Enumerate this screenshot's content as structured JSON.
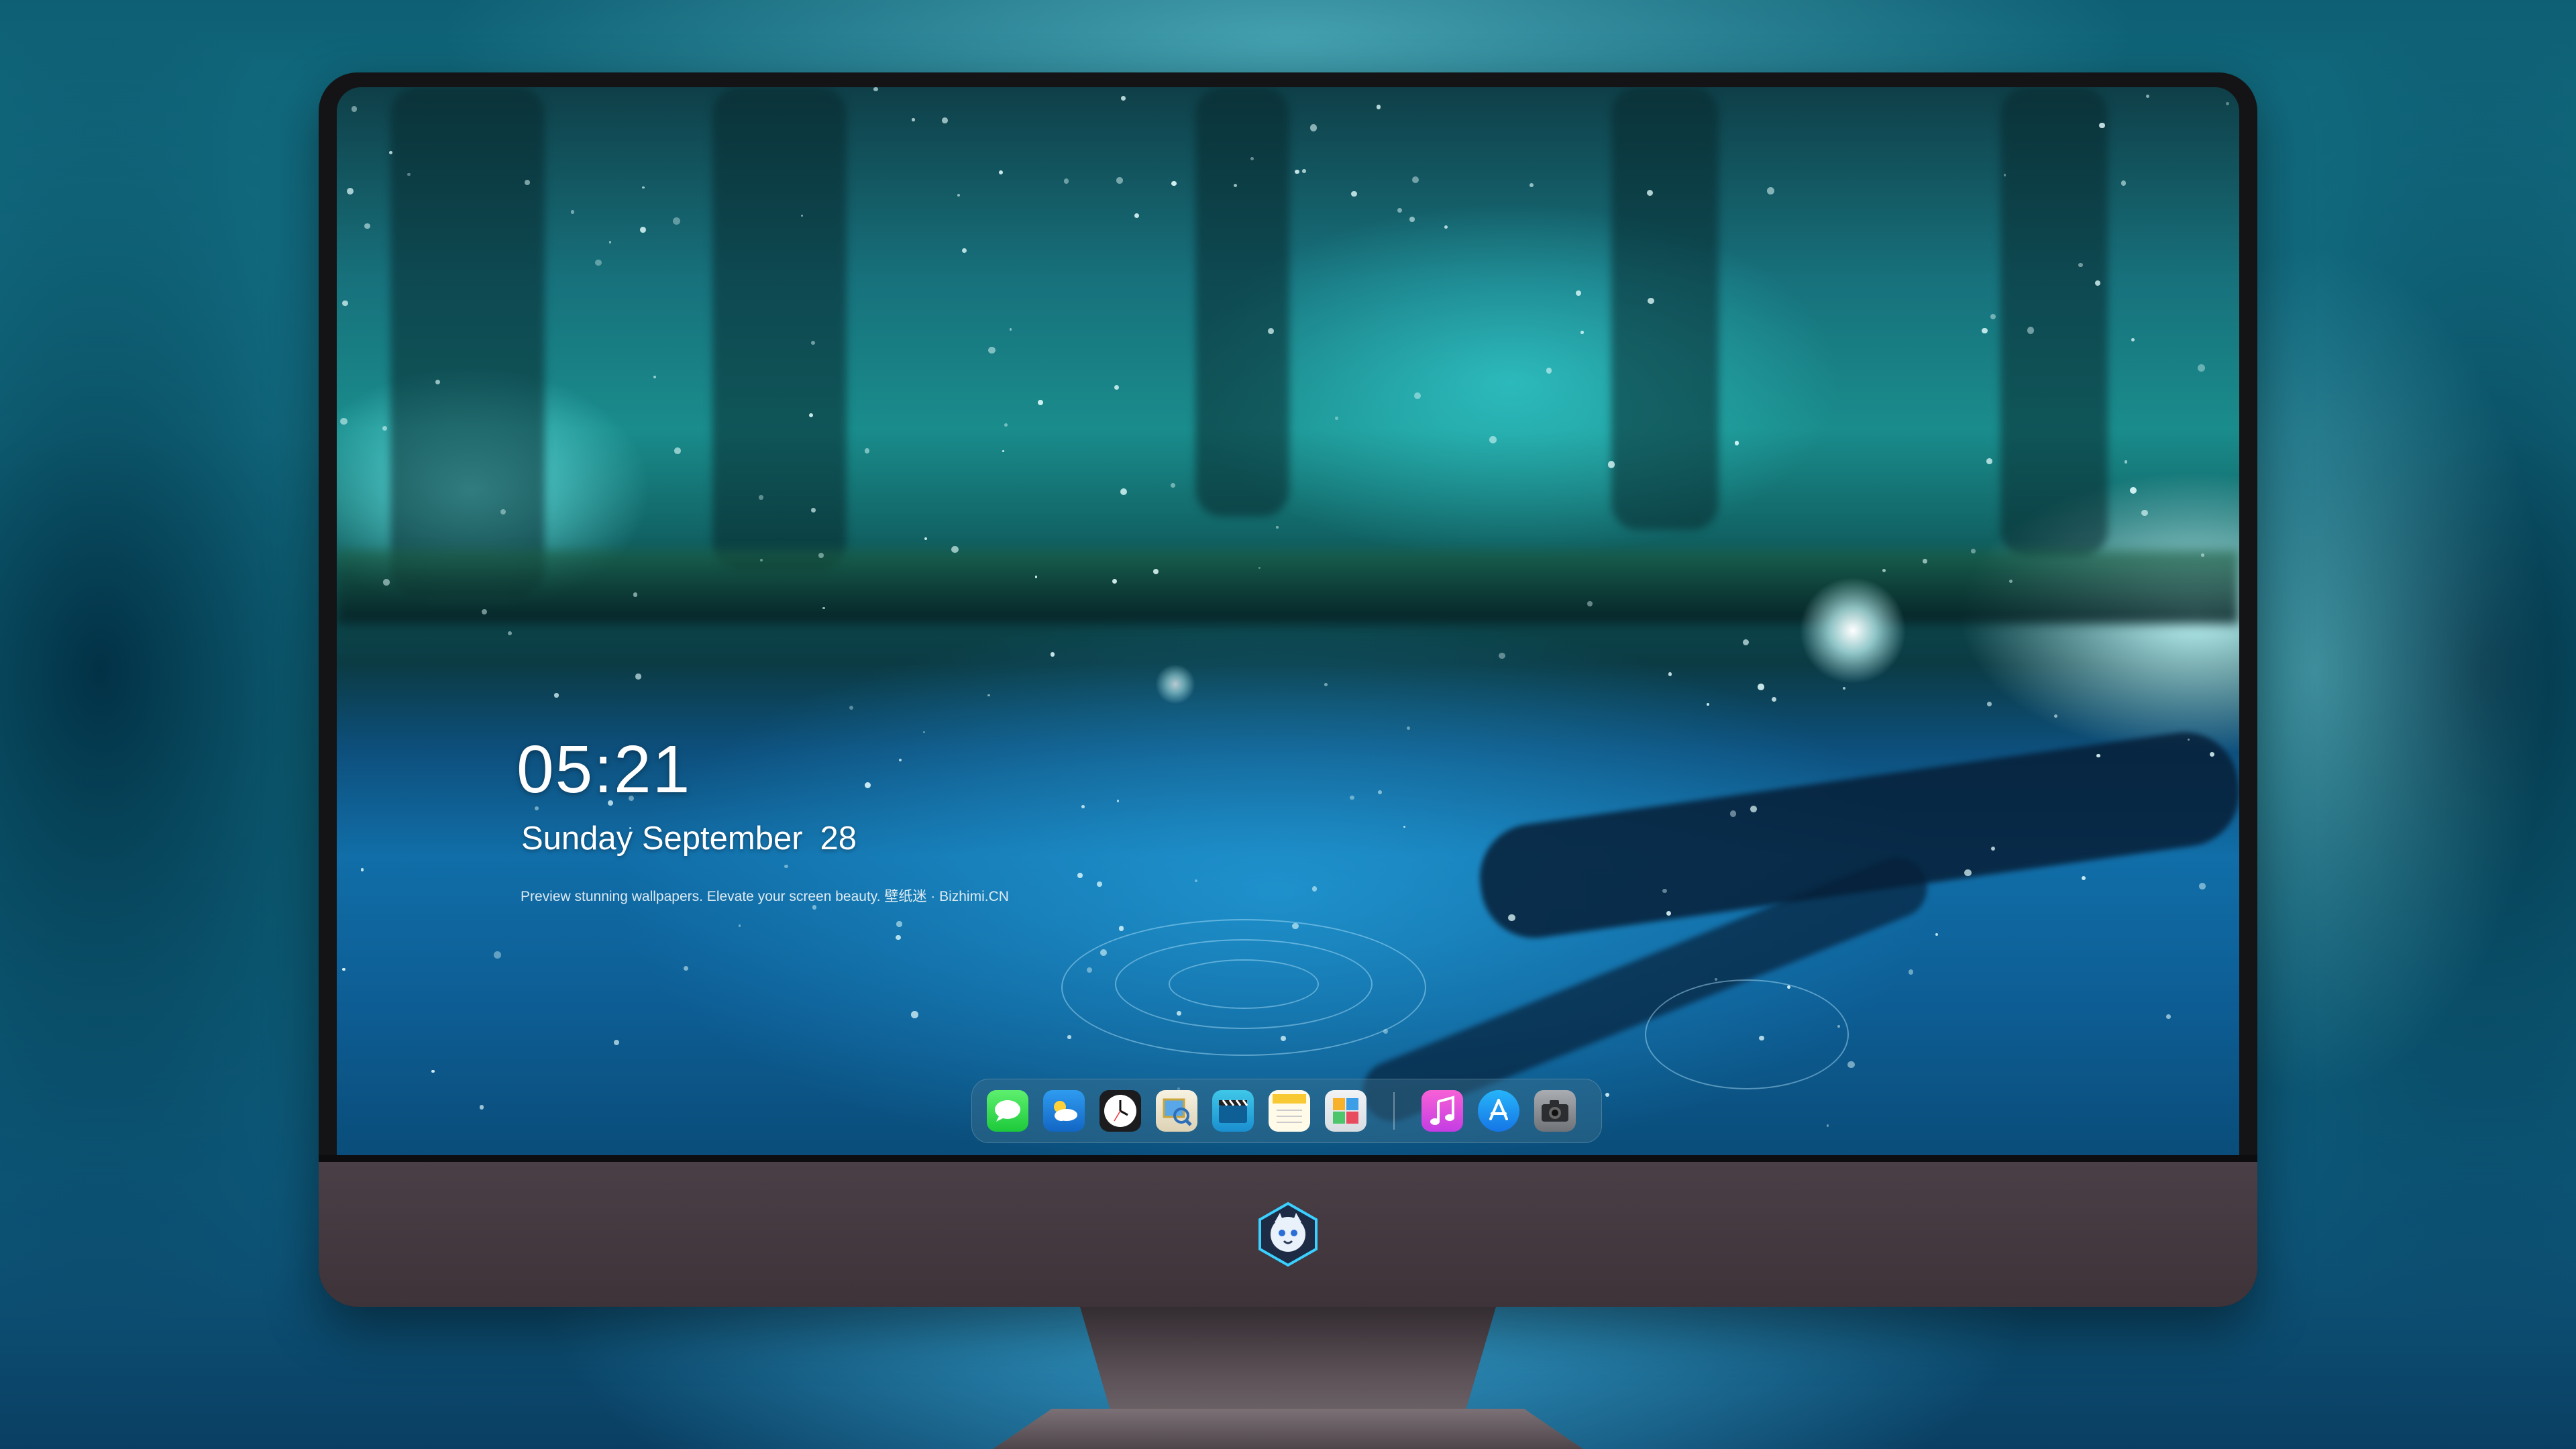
{
  "lock_screen": {
    "time": "05:21",
    "weekday": "Sunday",
    "month": "September",
    "day": "28",
    "tagline": "Preview stunning wallpapers. Elevate your screen beauty. 壁纸迷 · Bizhimi.CN"
  },
  "dock": {
    "apps": [
      {
        "name": "messages-icon",
        "label": "Messages"
      },
      {
        "name": "weather-icon",
        "label": "Weather"
      },
      {
        "name": "clock-icon",
        "label": "Clock"
      },
      {
        "name": "preview-icon",
        "label": "Preview"
      },
      {
        "name": "video-icon",
        "label": "Video"
      },
      {
        "name": "notes-icon",
        "label": "Notes"
      },
      {
        "name": "photos-icon",
        "label": "Photos"
      },
      {
        "name": "music-icon",
        "label": "Music"
      },
      {
        "name": "app-store-icon",
        "label": "App Store"
      },
      {
        "name": "camera-icon",
        "label": "Camera"
      }
    ]
  },
  "colors": {
    "bezel": "#141416",
    "chin": "#4a3f46",
    "accent": "#2fd0e0"
  }
}
